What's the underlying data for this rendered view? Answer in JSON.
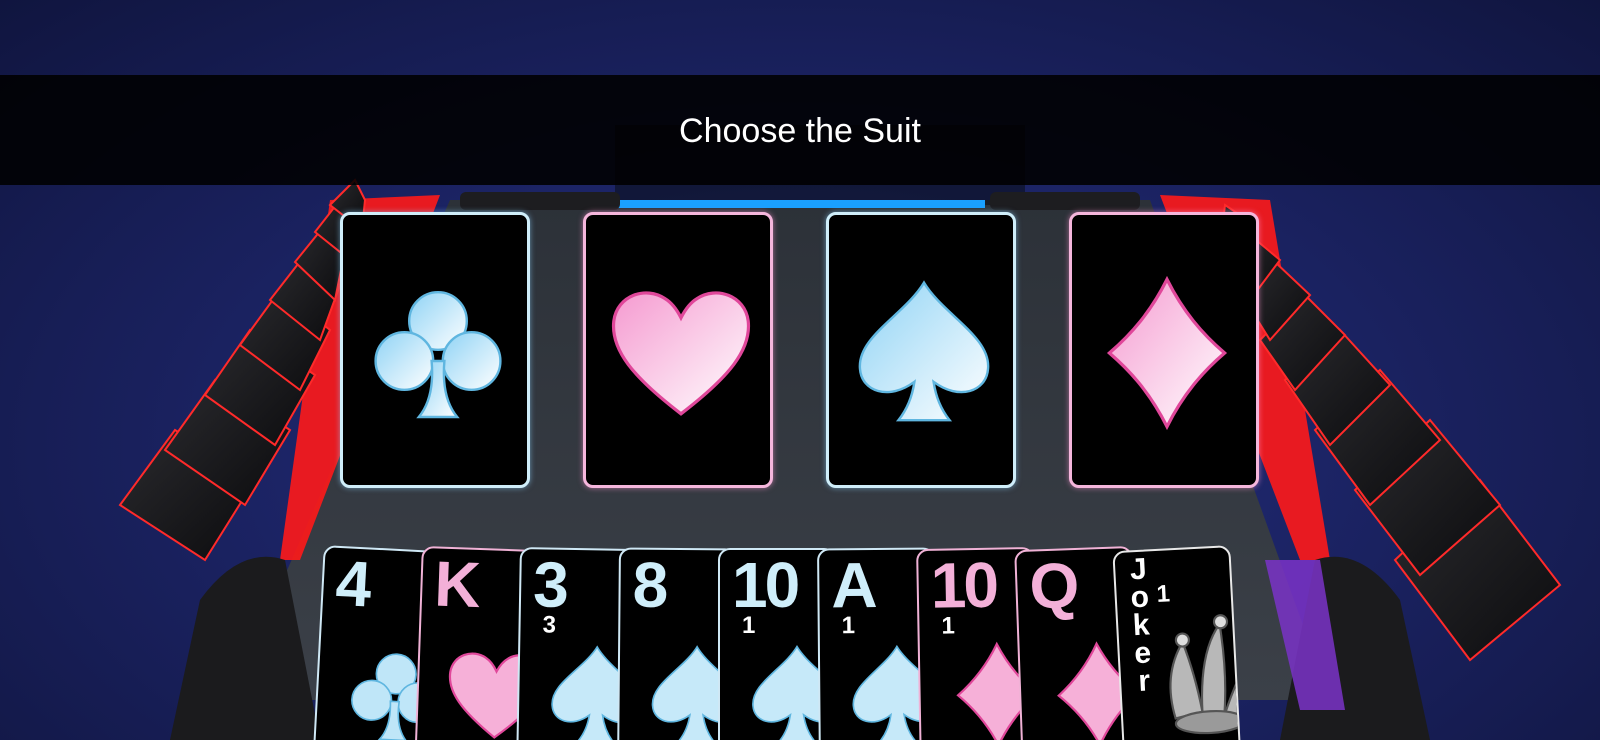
{
  "banner": {
    "title": "Choose the Suit"
  },
  "suit_choices": [
    {
      "suit": "clubs",
      "icon": "club-icon",
      "color": "#cfeefa"
    },
    {
      "suit": "hearts",
      "icon": "heart-icon",
      "color": "#f7b2dc"
    },
    {
      "suit": "spades",
      "icon": "spade-icon",
      "color": "#cfeefa"
    },
    {
      "suit": "diamonds",
      "icon": "diamond-icon",
      "color": "#f7b2dc"
    }
  ],
  "hand": [
    {
      "rank": "4",
      "count": "",
      "suit": "clubs"
    },
    {
      "rank": "K",
      "count": "",
      "suit": "hearts"
    },
    {
      "rank": "3",
      "count": "3",
      "suit": "spades"
    },
    {
      "rank": "8",
      "count": "",
      "suit": "spades"
    },
    {
      "rank": "10",
      "count": "1",
      "suit": "spades"
    },
    {
      "rank": "A",
      "count": "1",
      "suit": "spades"
    },
    {
      "rank": "10",
      "count": "1",
      "suit": "diamonds"
    },
    {
      "rank": "Q",
      "count": "",
      "suit": "diamonds"
    },
    {
      "rank": "Joker",
      "count": "1",
      "suit": "joker"
    }
  ],
  "colors": {
    "blue": "#cfeefa",
    "pink": "#f7b2dc",
    "table_edge": "#ff2222",
    "player_bar": "#1aa0ff"
  }
}
